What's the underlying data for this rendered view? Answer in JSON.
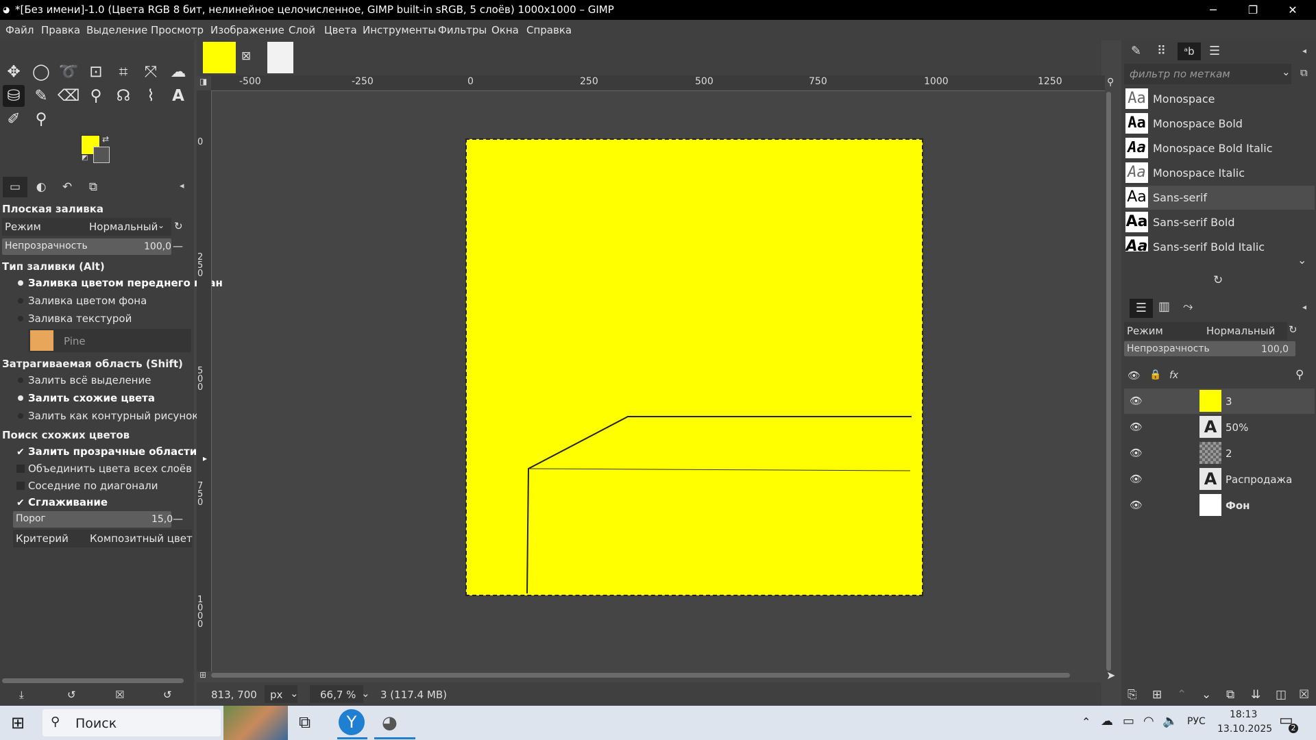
{
  "window": {
    "title": "*[Без имени]-1.0 (Цвета RGB 8 бит, нелинейное целочисленное, GIMP built-in sRGB, 5 слоёв) 1000x1000 – GIMP",
    "minimize": "─",
    "maximize": "❐",
    "close": "✕"
  },
  "menu": [
    "Файл",
    "Правка",
    "Выделение",
    "Просмотр",
    "Изображение",
    "Слой",
    "Цвета",
    "Инструменты",
    "Фильтры",
    "Окна",
    "Справка"
  ],
  "tool_options": {
    "title": "Плоская заливка",
    "mode_label": "Режим",
    "mode_value": "Нормальный",
    "opacity_label": "Непрозрачность",
    "opacity_value": "100,0",
    "fill_type_header": "Тип заливки  (Alt)",
    "fill_fg": "Заливка цветом переднего план",
    "fill_bg": "Заливка цветом фона",
    "fill_pattern": "Заливка текстурой",
    "pattern_name": "Pine",
    "area_header": "Затрагиваемая область  (Shift)",
    "area_selection": "Залить всё выделение",
    "area_similar": "Залить схожие цвета",
    "area_lineart": "Залить как контурный рисунок",
    "similar_header": "Поиск схожих цветов",
    "opt_transparent": "Залить прозрачные области",
    "opt_merged": "Объединить цвета всех слоёв",
    "opt_diagonal": "Соседние по диагонали",
    "opt_antialias": "Сглаживание",
    "threshold_label": "Порог",
    "threshold_value": "15,0",
    "criterion_label": "Критерий",
    "criterion_value": "Композитный цвет",
    "fill_type_selected": "fg",
    "area_selected": "similar",
    "checks": {
      "transparent": true,
      "merged": false,
      "diagonal": false,
      "antialias": true
    }
  },
  "colors": {
    "foreground": "#ffff00",
    "background": "#555555",
    "canvas": "#ffff00"
  },
  "rulers": {
    "top": [
      "-500",
      "-250",
      "0",
      "250",
      "500",
      "750",
      "1000",
      "1250"
    ],
    "left": [
      "0",
      "2\n5\n0",
      "5\n0\n0",
      "7\n5\n0",
      "1\n0\n0\n0"
    ]
  },
  "fonts": {
    "filter_placeholder": "фильтр по меткам",
    "items": [
      "Monospace",
      "Monospace Bold",
      "Monospace Bold Italic",
      "Monospace Italic",
      "Sans-serif",
      "Sans-serif Bold",
      "Sans-serif Bold Italic"
    ],
    "selected": "Sans-serif"
  },
  "layers": {
    "mode_label": "Режим",
    "mode_value": "Нормальный",
    "opacity_label": "Непрозрачность",
    "opacity_value": "100,0",
    "items": [
      {
        "name": "3",
        "kind": "yellow"
      },
      {
        "name": "50%",
        "kind": "text"
      },
      {
        "name": "2",
        "kind": "checker"
      },
      {
        "name": "Распродажа",
        "kind": "text"
      },
      {
        "name": "Фон",
        "kind": "white"
      }
    ]
  },
  "status": {
    "coords": "813, 700",
    "unit": "px",
    "zoom": "66,7 %",
    "info": "3 (117.4 MB)"
  },
  "taskbar": {
    "search": "Поиск",
    "lang": "РУС",
    "time": "18:13",
    "date": "13.10.2025",
    "notif_count": "2"
  }
}
